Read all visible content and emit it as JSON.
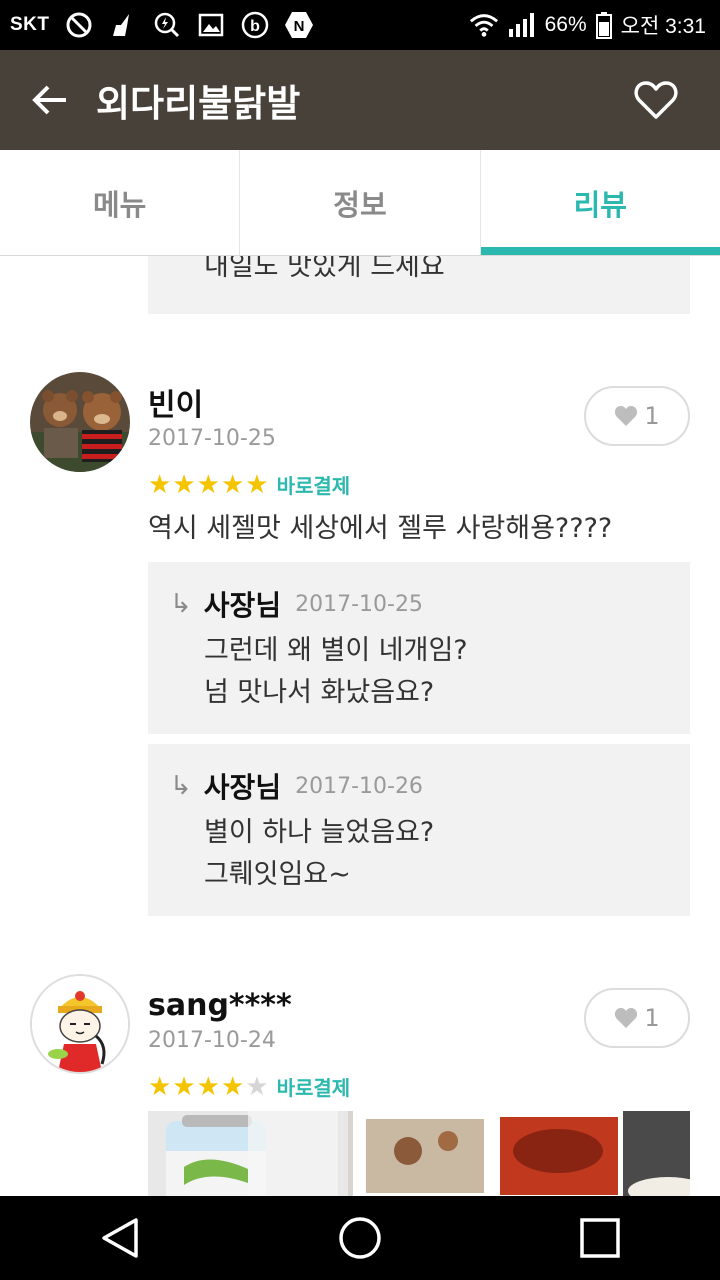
{
  "status_bar": {
    "carrier": "SKT",
    "battery": "66%",
    "time": "오전 3:31",
    "icons": [
      "no-disturb-icon",
      "cleaner-icon",
      "search-bolt-icon",
      "gallery-icon",
      "b-app-icon",
      "naver-icon",
      "wifi-icon",
      "signal-icon",
      "battery-icon"
    ]
  },
  "app_bar": {
    "title": "외다리불닭발",
    "back_icon": "arrow-left-icon",
    "favorite_icon": "heart-outline-icon"
  },
  "tabs": [
    {
      "label": "메뉴",
      "active": false
    },
    {
      "label": "정보",
      "active": false
    },
    {
      "label": "리뷰",
      "active": true
    }
  ],
  "partial_reply": {
    "text": "내일도 맛있게 드세요"
  },
  "reviews": [
    {
      "name": "빈이",
      "date": "2017-10-25",
      "likes": "1",
      "rating": 5,
      "badge": "바로결제",
      "text": "역시 세젤맛 세상에서 젤루 사랑해용????",
      "replies": [
        {
          "author": "사장님",
          "date": "2017-10-25",
          "lines": [
            "그런데 왜 별이 네개임?",
            "넘 맛나서 화났음요?"
          ]
        },
        {
          "author": "사장님",
          "date": "2017-10-26",
          "lines": [
            "별이 하나 늘었음요?",
            "그뤠잇임요~"
          ]
        }
      ]
    },
    {
      "name": "sang****",
      "date": "2017-10-24",
      "likes": "1",
      "rating": 4,
      "badge": "바로결제"
    }
  ],
  "colors": {
    "app_bar": "#47413a",
    "accent": "#2bb8ae",
    "star": "#f5c400"
  }
}
